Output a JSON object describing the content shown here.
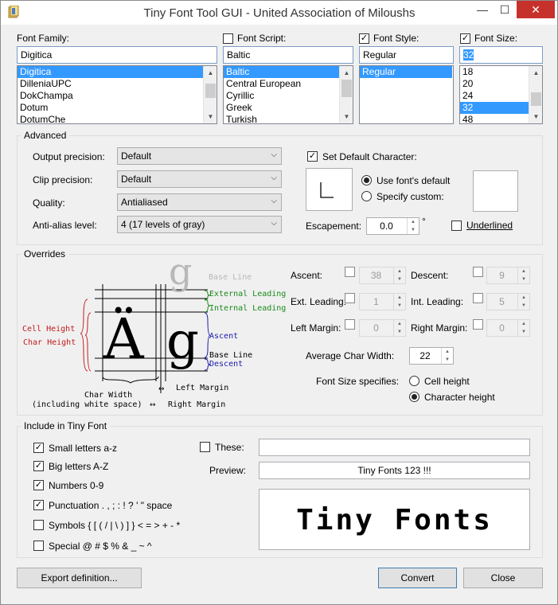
{
  "window": {
    "title": "Tiny Font Tool GUI - United Association of Miloushs",
    "controls": {
      "minimize": "—",
      "maximize": "☐",
      "close": "✕"
    }
  },
  "font_family": {
    "label": "Font Family:",
    "value": "Digitica",
    "items": [
      "Digitica",
      "DilleniaUPC",
      "DokChampa",
      "Dotum",
      "DotumChe"
    ]
  },
  "font_script": {
    "label": "Font Script:",
    "value": "Baltic",
    "items": [
      "Baltic",
      "Central European",
      "Cyrillic",
      "Greek",
      "Turkish"
    ]
  },
  "font_style": {
    "label": "Font Style:",
    "value": "Regular",
    "items": [
      "Regular"
    ]
  },
  "font_size": {
    "label": "Font Size:",
    "value": "32",
    "items": [
      "18",
      "20",
      "24",
      "32",
      "48"
    ]
  },
  "advanced": {
    "title": "Advanced",
    "output_precision_label": "Output precision:",
    "output_precision": "Default",
    "clip_precision_label": "Clip precision:",
    "clip_precision": "Default",
    "quality_label": "Quality:",
    "quality": "Antialiased",
    "antialias_label": "Anti-alias level:",
    "antialias": "4 (17 levels of gray)",
    "set_default_char_label": "Set Default Character:",
    "use_default_label": "Use font's default",
    "specify_custom_label": "Specify custom:",
    "escapement_label": "Escapement:",
    "escapement": "0.0",
    "degree": "°",
    "underlined_label": "Underlined"
  },
  "overrides": {
    "title": "Overrides",
    "ascent_label": "Ascent:",
    "ascent": "38",
    "descent_label": "Descent:",
    "descent": "9",
    "ext_leading_label": "Ext. Leading:",
    "ext_leading": "1",
    "int_leading_label": "Int. Leading:",
    "int_leading": "5",
    "left_margin_label": "Left Margin:",
    "left_margin": "0",
    "right_margin_label": "Right Margin:",
    "right_margin": "0",
    "avg_char_width_label": "Average Char Width:",
    "avg_char_width": "22",
    "font_size_specifies_label": "Font Size specifies:",
    "cell_height_label": "Cell height",
    "char_height_label": "Character height"
  },
  "diagram": {
    "glyph_a": "Ä",
    "glyph_g": "g",
    "glyph_ghost": "g",
    "base_line_top": "Base Line",
    "external_leading": "External Leading",
    "internal_leading": "Internal Leading",
    "ascent": "Ascent",
    "base_line": "Base Line",
    "descent": "Descent",
    "cell_height": "Cell Height",
    "char_height": "Char Height",
    "char_width": "Char Width",
    "including_ws": "(including white space)",
    "left_margin": "Left Margin",
    "right_margin": "Right Margin",
    "colors": {
      "green": "#1a8a1a",
      "blue": "#1a1aaa",
      "red": "#c41a1a",
      "gray": "#b0b0b0"
    }
  },
  "include": {
    "title": "Include in Tiny Font",
    "small_letters": "Small letters a-z",
    "big_letters": "Big letters A-Z",
    "numbers": "Numbers 0-9",
    "punctuation": "Punctuation . , ; : ! ? ' \" space",
    "symbols": "Symbols { [ ( / | \\ ) ] } < = > + - *",
    "special": "Special @ # $ % & _ ~ ^",
    "these_label": "These:",
    "these_value": "",
    "preview_label": "Preview:",
    "preview_value": "Tiny Fonts 123 !!!",
    "preview_render": "Tiny Fonts"
  },
  "buttons": {
    "export": "Export definition...",
    "convert": "Convert",
    "close": "Close"
  }
}
